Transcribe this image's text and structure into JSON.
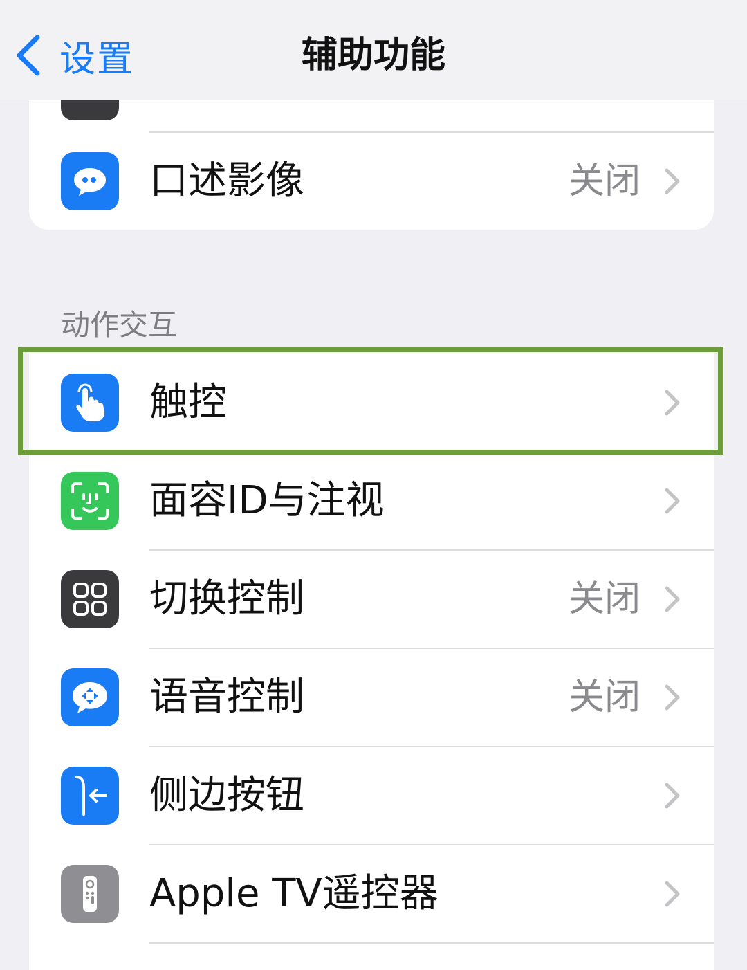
{
  "nav": {
    "back_label": "设置",
    "title": "辅助功能"
  },
  "vision_section": {
    "items": [
      {
        "label": "口述影像",
        "value": "关闭",
        "icon": "audio-description-icon",
        "color": "#1a7cf5"
      }
    ]
  },
  "interaction_section": {
    "header": "动作交互",
    "items": [
      {
        "label": "触控",
        "value": "",
        "icon": "touch-hand-icon",
        "color": "#1a7cf5"
      },
      {
        "label": "面容ID与注视",
        "value": "",
        "icon": "face-id-icon",
        "color": "#35c759"
      },
      {
        "label": "切换控制",
        "value": "关闭",
        "icon": "switch-control-icon",
        "color": "#3a3a3c"
      },
      {
        "label": "语音控制",
        "value": "关闭",
        "icon": "voice-control-icon",
        "color": "#1a7cf5"
      },
      {
        "label": "侧边按钮",
        "value": "",
        "icon": "side-button-icon",
        "color": "#1a7cf5"
      },
      {
        "label": "Apple TV遥控器",
        "value": "",
        "icon": "tv-remote-icon",
        "color": "#8e8e93"
      }
    ]
  },
  "highlight_color": "#6c9d3a"
}
